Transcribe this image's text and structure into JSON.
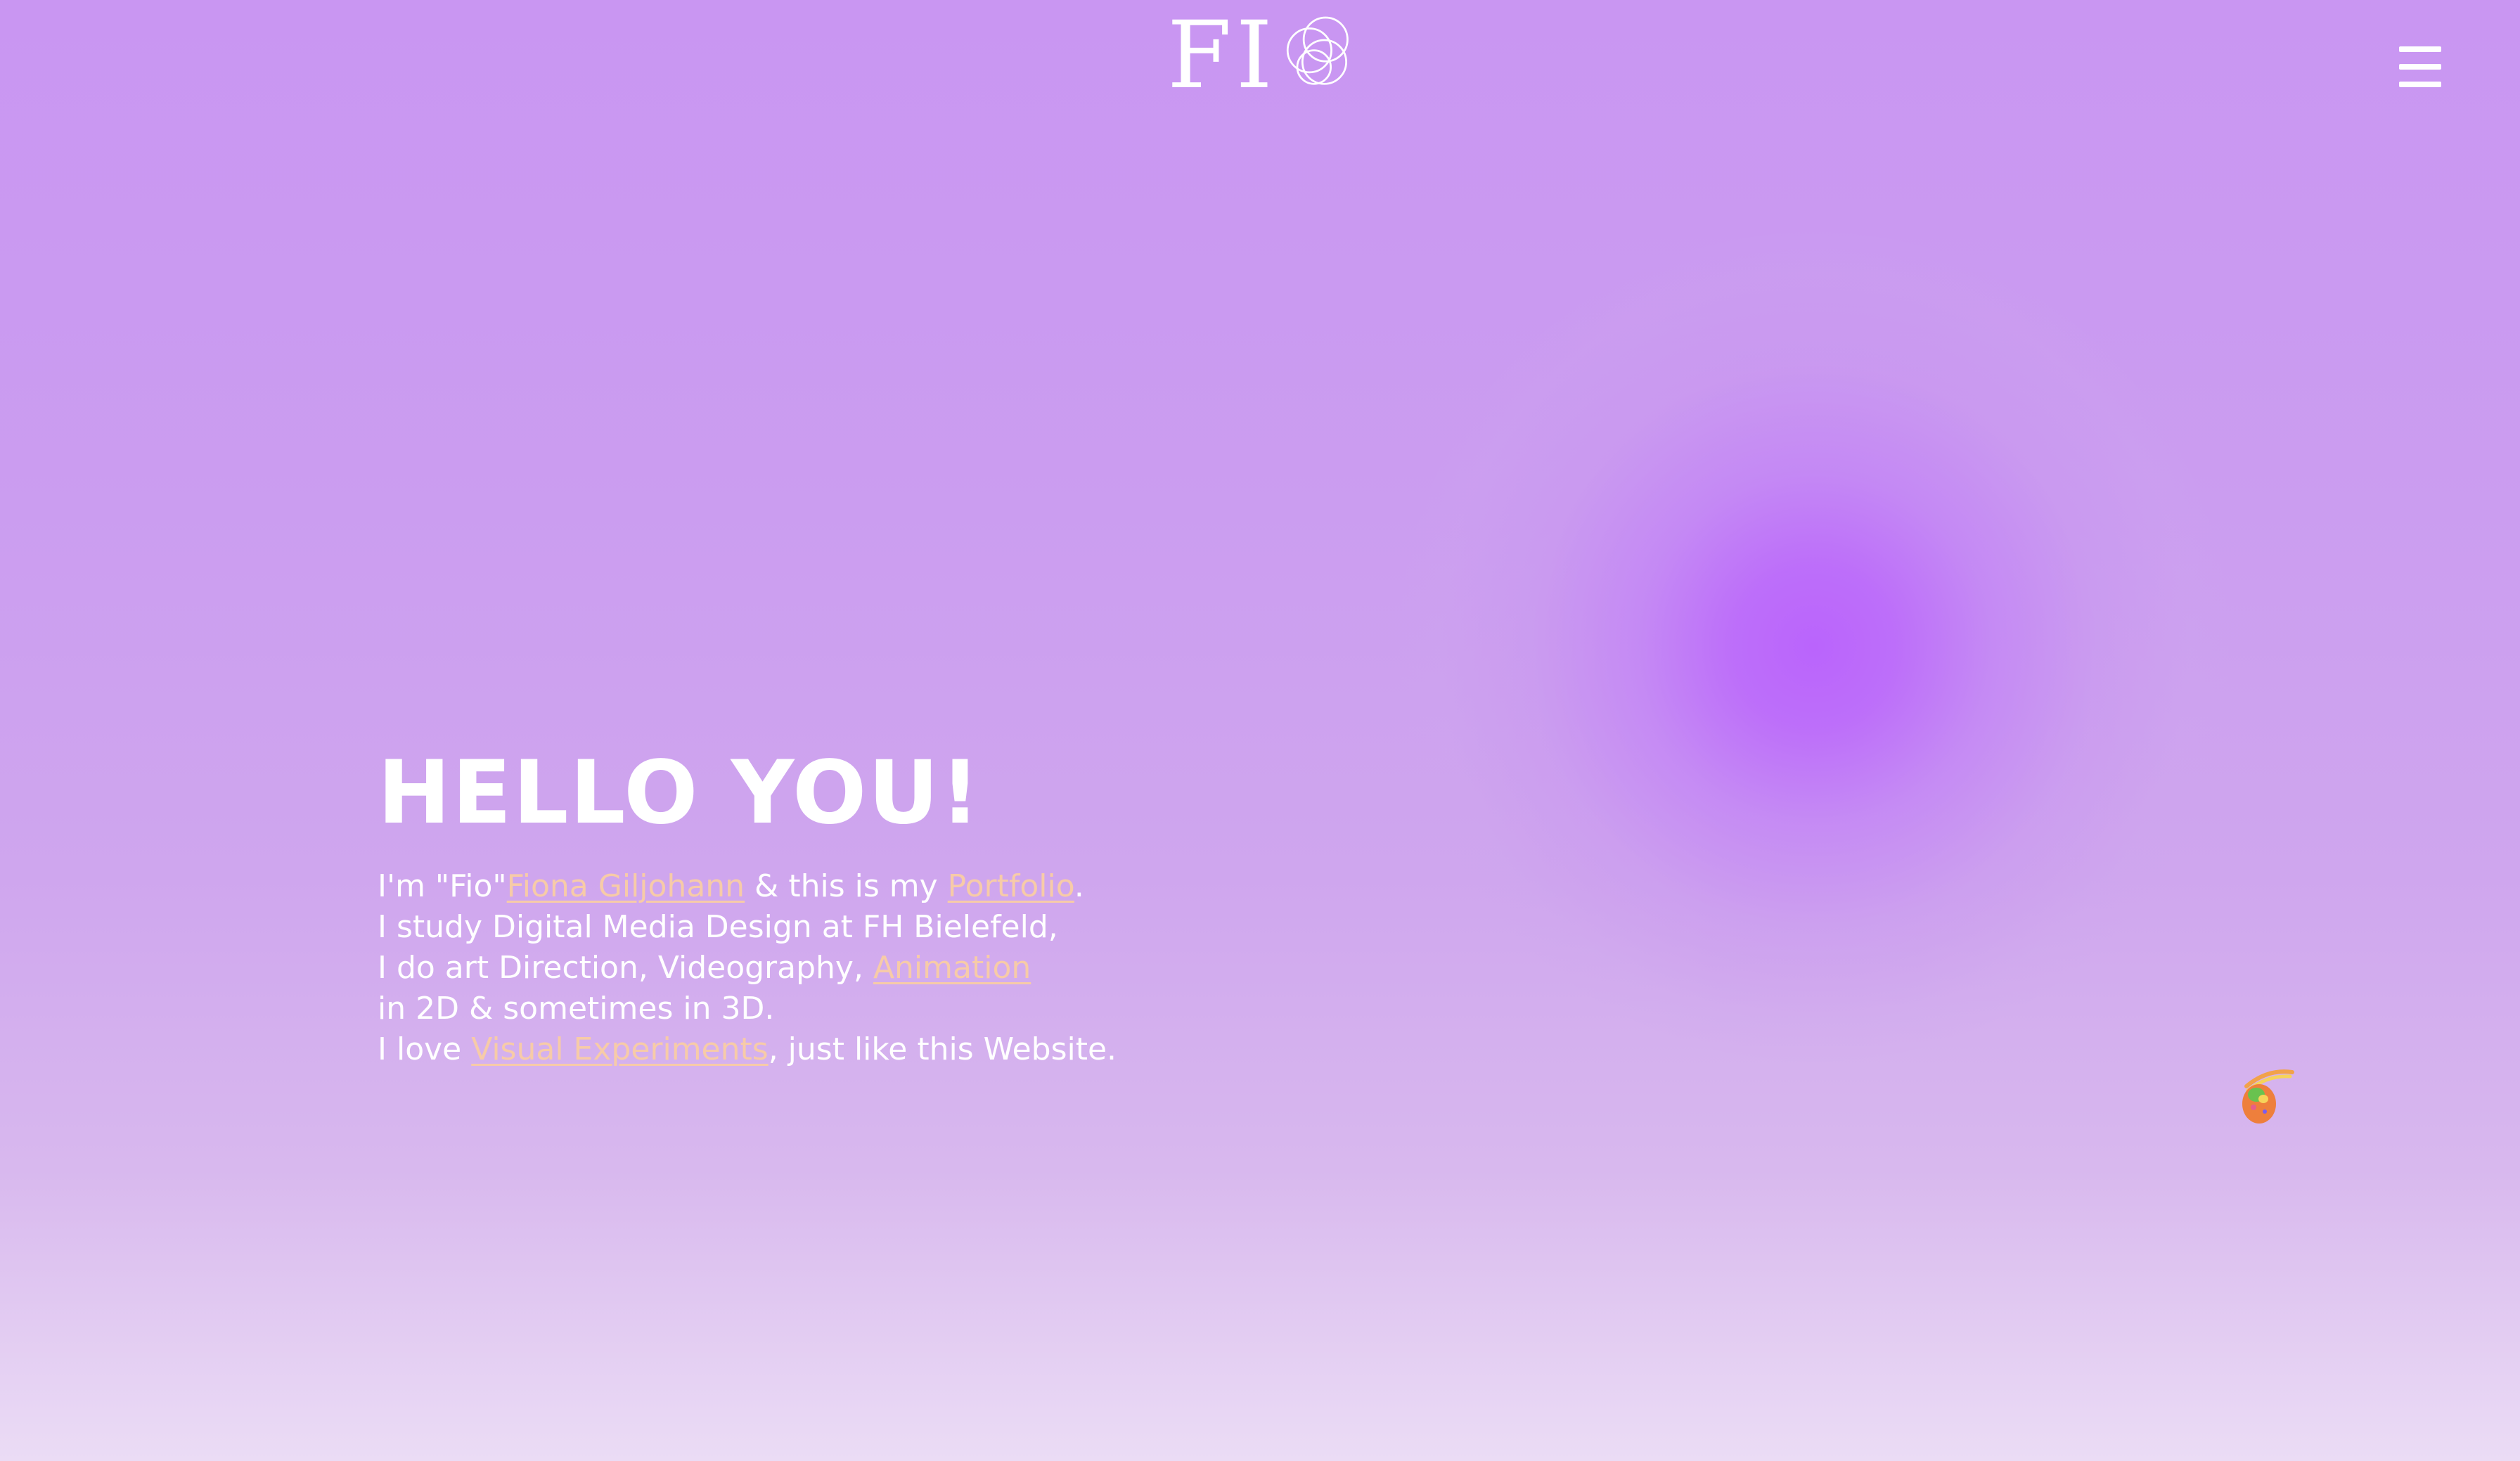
{
  "header": {
    "logo_text": "FI",
    "logo_icon": "rings-icon",
    "menu_icon": "hamburger-menu-icon"
  },
  "hero": {
    "title": "HELLO YOU!",
    "line1": {
      "pre": "I'm \"Fio\"",
      "link1": "Fiona Giljohann",
      "mid": " & this is my ",
      "link2": "Portfolio",
      "post": "."
    },
    "line2": "I study Digital Media Design at FH Bielefeld,",
    "line3": {
      "pre": "I do art Direction, Videography, ",
      "link": "Animation"
    },
    "line4": "in 2D & sometimes in 3D.",
    "line5": {
      "pre": "I love ",
      "link": "Visual Experiments",
      "post": ", just like this Website."
    }
  },
  "decor": {
    "glow_icon": "purple-glow-orb",
    "mascot_icon": "rainbow-mascot-icon"
  },
  "colors": {
    "background_top": "#c996f2",
    "background_bottom": "#ebdcf5",
    "glow": "#ba64fc",
    "link": "#f7cba8",
    "text": "#ffffff"
  }
}
